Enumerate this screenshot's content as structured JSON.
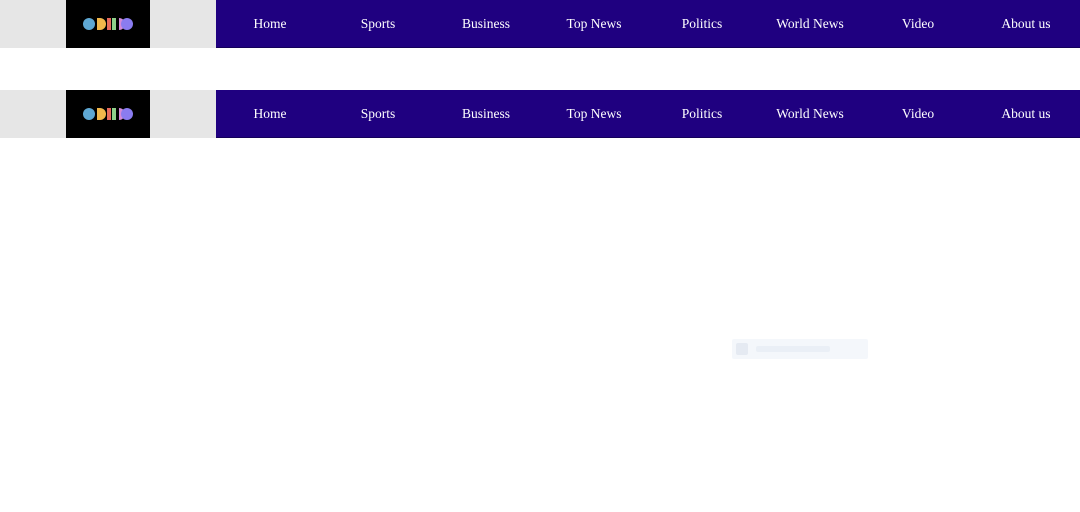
{
  "colors": {
    "nav_background": "#1f0080",
    "logo_area_background": "#e6e6e6",
    "logo_box_background": "#000000",
    "nav_text": "#ffffff"
  },
  "logo": {
    "icon": "colorful-shapes-logo-icon"
  },
  "nav_primary": {
    "items": [
      {
        "label": "Home"
      },
      {
        "label": "Sports"
      },
      {
        "label": "Business"
      },
      {
        "label": "Top News"
      },
      {
        "label": "Politics"
      },
      {
        "label": "World News"
      },
      {
        "label": "Video"
      },
      {
        "label": "About us"
      }
    ]
  },
  "nav_secondary": {
    "items": [
      {
        "label": "Home"
      },
      {
        "label": "Sports"
      },
      {
        "label": "Business"
      },
      {
        "label": "Top News"
      },
      {
        "label": "Politics"
      },
      {
        "label": "World News"
      },
      {
        "label": "Video"
      },
      {
        "label": "About us"
      }
    ]
  }
}
